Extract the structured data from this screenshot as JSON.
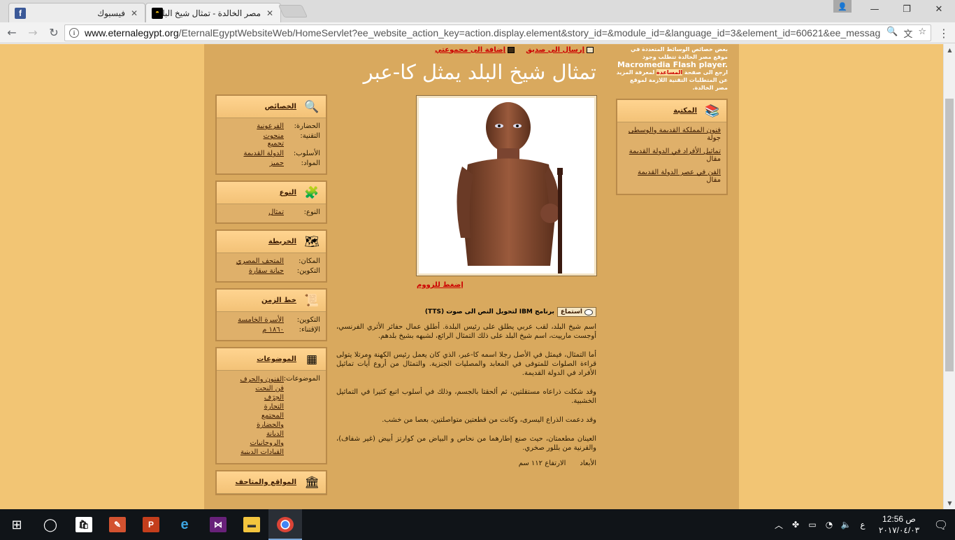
{
  "browser": {
    "tabs": [
      {
        "title": "فيسبوك",
        "icon": "facebook-icon"
      },
      {
        "title": "مصر الخالدة - تمثال شيخ البلد يمثل كا-عبر",
        "icon": "eternal-egypt-icon"
      }
    ],
    "url_host": "www.eternalegypt.org",
    "url_path": "/EternalEgyptWebsiteWeb/HomeServlet?ee_website_action_key=action.display.element&story_id=&module_id=&language_id=3&element_id=60621&ee_messag"
  },
  "flash_note": {
    "line1": "بعض خصائص الوسائط المتعددة في موقع مصر الخالدة تتطلب وجود",
    "product": "Macromedia Flash player.",
    "line2_pre": "ارجع الى صفحة",
    "help_link": "المساعدة",
    "line2_post": "لمعرفة المزيد عن المتطلبات التقنية اللازمة لموقع مصر الخالدة."
  },
  "library": {
    "title": "المكتبة",
    "items": [
      {
        "link": "فنون المملكة القديمة والوسطى",
        "type": "جولة"
      },
      {
        "link": "تماثيل الأفراد في الدولة القديمة",
        "type": "مقال"
      },
      {
        "link": "الفن في عصر الدولة القديمة",
        "type": "مقال"
      }
    ]
  },
  "actions": {
    "send_friend": "إرسال الى صديق",
    "add_collection": "إضافة الى مجموعتي"
  },
  "title": "تمثال شيخ البلد يمثل كا-عبر",
  "zoom_label": "إضغط للزووم",
  "tts": {
    "listen": "استماع",
    "label": "برنامج IBM لتحويل النص الى صوت (TTS)"
  },
  "description": [
    "اسم شيخ البلد، لقب عربي يطلق على رئيس البلدة. أطلق عمال حفائر الأثري الفرنسي، أوجست مارييت، اسم شيخ البلد على ذلك التمثال الرائع، لشبهه بشيخ بلدهم.",
    "أما التمثال، فيمثل في الأصل رجلا اسمه كا-عبر، الذي كان يعمل رئيس الكهنة ومرتلا يتولى قراءة الصلوات للمتوفى في المعابد والمصليات الجنزية. والتمثال من أروع آيات تماثيل الأفراد في الدولة القديمة.",
    "وقد شكلت ذراعاه مستقلتين، ثم ألحقتا بالجسم، وذلك في أسلوب اتبع كثيرا في التماثيل الخشبية.",
    "وقد دعمت الذراع اليسرى، وكانت من قطعتين متواصلتين، بعصا من خشب.",
    "العينان مطعمتان، حيث صنع إطارهما من نحاس و البياض من كوارتز أبيض (غير شفاف)، والقرنية من بللور صخري."
  ],
  "dimensions": {
    "label": "الأبعاد",
    "value": "الارتفاع ١١٢ سم"
  },
  "properties": {
    "title": "الخصائص",
    "rows": [
      {
        "key": "الحضارة:",
        "values": [
          "الفرعونية"
        ]
      },
      {
        "key": "التقنية:",
        "values": [
          "منحوت",
          "تجميع"
        ]
      },
      {
        "key": "الأسلوب:",
        "values": [
          "الدولة القديمة"
        ]
      },
      {
        "key": "المواد:",
        "values": [
          "جميز"
        ]
      }
    ]
  },
  "type_box": {
    "title": "النوع",
    "rows": [
      {
        "key": "النوع:",
        "values": [
          "تمثال"
        ]
      }
    ]
  },
  "map_box": {
    "title": "الخريطة",
    "rows": [
      {
        "key": "المكان:",
        "values": [
          "المتحف المصري"
        ]
      },
      {
        "key": "التكوين:",
        "values": [
          "جبانة سقارة"
        ]
      }
    ]
  },
  "timeline_box": {
    "title": "خط الزمن",
    "rows": [
      {
        "key": "التكوين:",
        "values": [
          "الأسرة الخامسة"
        ]
      },
      {
        "key": "الإقتناء:",
        "values": [
          "١٨٦٠ م"
        ]
      }
    ]
  },
  "topics_box": {
    "title": "الموضوعات",
    "rows": [
      {
        "key": "الموضوعات:",
        "values": [
          "الفنون والحرف",
          "فن النحت",
          "الحِرَف",
          "التجارة",
          "المجتمع",
          "والحضارة",
          "الديانة",
          "والروحانيات",
          "القيادات الدينية"
        ]
      }
    ]
  },
  "sites_box": {
    "title": "المواقع والمتاحف"
  },
  "taskbar": {
    "time": "12:56 ص",
    "date": "٢٠١٧/٠٤/٠٣",
    "lang": "ع"
  }
}
